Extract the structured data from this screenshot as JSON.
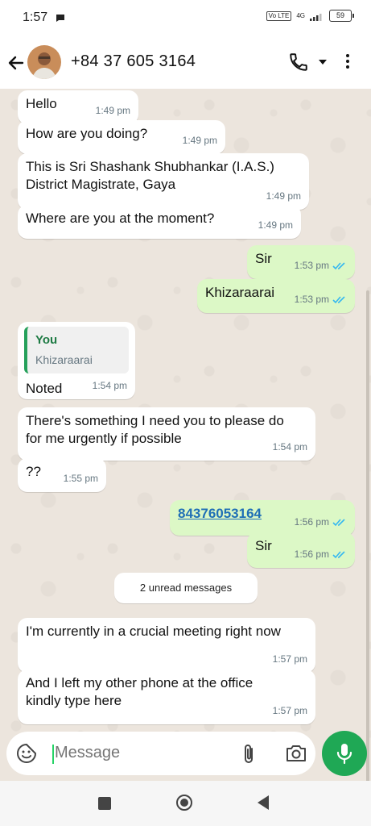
{
  "status_bar": {
    "time": "1:57",
    "network": "4G",
    "volte": "Vo LTE",
    "battery": "59"
  },
  "header": {
    "contact": "+84 37 605 3164"
  },
  "messages": [
    {
      "dir": "in",
      "text": "Hello",
      "time": "1:49 pm"
    },
    {
      "dir": "in",
      "text": "How are you doing?",
      "time": "1:49 pm"
    },
    {
      "dir": "in",
      "text": "This is Sri Shashank Shubhankar (I.A.S.) District Magistrate, Gaya",
      "time": "1:49 pm"
    },
    {
      "dir": "in",
      "text": "Where are you at the moment?",
      "time": "1:49 pm"
    },
    {
      "dir": "out",
      "text": "Sir",
      "time": "1:53 pm"
    },
    {
      "dir": "out",
      "text": "Khizaraarai",
      "time": "1:53 pm"
    },
    {
      "dir": "in",
      "quote_author": "You",
      "quote_text": "Khizaraarai",
      "text": "Noted",
      "time": "1:54 pm"
    },
    {
      "dir": "in",
      "text": "There's something I need you to please do for me urgently if possible",
      "time": "1:54 pm"
    },
    {
      "dir": "in",
      "text": "??",
      "time": "1:55 pm"
    },
    {
      "dir": "out",
      "text": "84376053164",
      "time": "1:56 pm"
    },
    {
      "dir": "out",
      "text": "Sir",
      "time": "1:56 pm"
    },
    {
      "dir": "in",
      "text": "I'm currently in a crucial meeting right now",
      "time": "1:57 pm"
    },
    {
      "dir": "in",
      "text": "And I left my other phone at the office kindly type here",
      "time": "1:57 pm"
    }
  ],
  "unread_banner": "2 unread messages",
  "composer": {
    "placeholder": "Message"
  },
  "icons": {
    "back": "arrow-left-icon",
    "call": "phone-icon",
    "menu": "more-vertical-icon",
    "emoji": "sticker-icon",
    "attach": "paperclip-icon",
    "camera": "camera-icon",
    "mic": "microphone-icon"
  },
  "colors": {
    "accent": "#1fa855",
    "outgoing": "#dcf8c6",
    "incoming": "#ffffff",
    "read_tick": "#34b7f1",
    "link": "#1f6fb6"
  }
}
